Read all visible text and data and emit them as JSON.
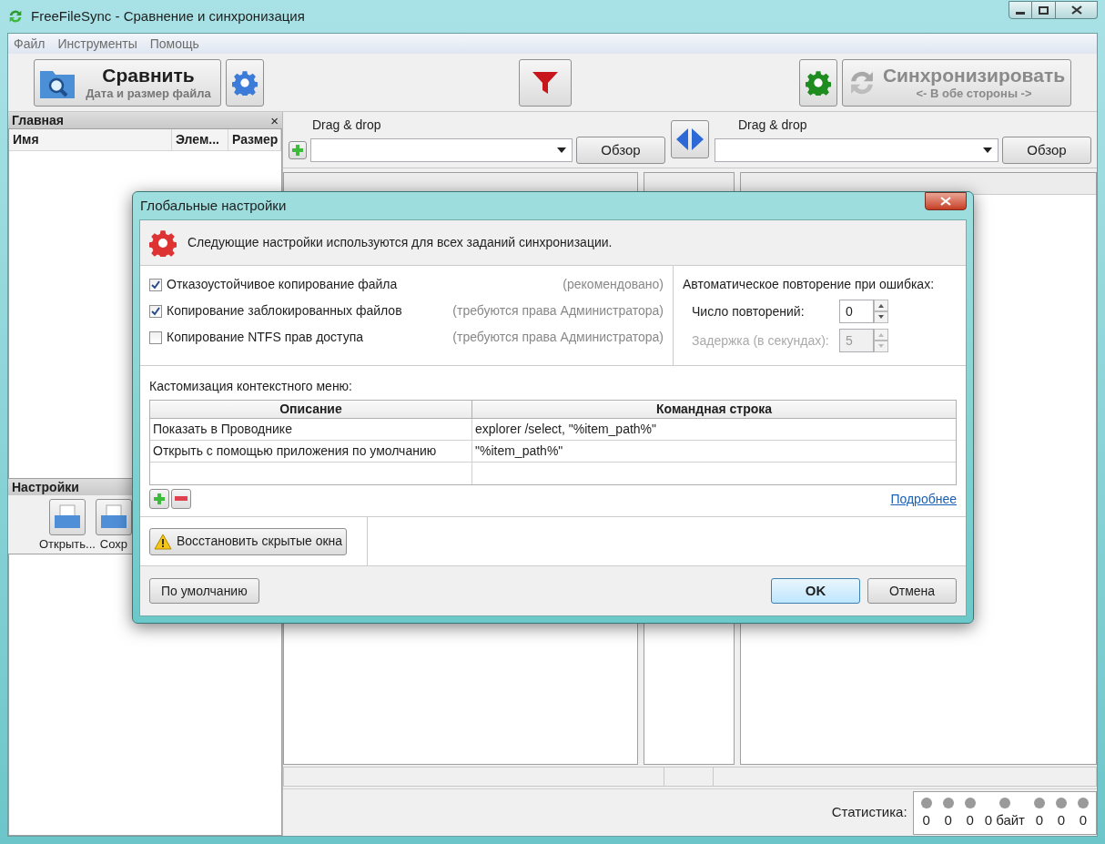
{
  "window": {
    "title": "FreeFileSync - Сравнение и синхронизация"
  },
  "menu": [
    "Файл",
    "Инструменты",
    "Помощь"
  ],
  "toolbar": {
    "compare": {
      "label": "Сравнить",
      "sublabel": "Дата и размер файла"
    },
    "sync": {
      "label": "Синхронизировать",
      "sublabel": "<- В обе стороны ->"
    }
  },
  "left_panel": {
    "title": "Главная",
    "close": "×",
    "columns": [
      "Имя",
      "Элем...",
      "Размер"
    ]
  },
  "folders": [
    {
      "label": "Drag & drop",
      "browse": "Обзор"
    },
    {
      "label": "Drag & drop",
      "browse": "Обзор"
    }
  ],
  "settings_panel": {
    "title": "Настройки",
    "buttons": [
      "Открыть...",
      "Сохр"
    ]
  },
  "statistics": {
    "label": "Статистика:",
    "counts": [
      "0",
      "0",
      "0",
      "0 байт",
      "0",
      "0",
      "0"
    ]
  },
  "dialog": {
    "title": "Глобальные настройки",
    "info": "Следующие настройки используются для всех заданий синхронизации.",
    "options": [
      {
        "label": "Отказоустойчивое копирование файла",
        "note": "(рекомендовано)",
        "checked": true
      },
      {
        "label": "Копирование заблокированных файлов",
        "note": "(требуются права Администратора)",
        "checked": true
      },
      {
        "label": "Копирование NTFS прав доступа",
        "note": "(требуются права Администратора)",
        "checked": false
      }
    ],
    "retry": {
      "title": "Автоматическое повторение при ошибках:",
      "fields": [
        {
          "label": "Число повторений:",
          "value": "0",
          "disabled": false
        },
        {
          "label": "Задержка (в секундах):",
          "value": "5",
          "disabled": true
        }
      ]
    },
    "context_menu": {
      "title": "Кастомизация контекстного меню:",
      "columns": [
        "Описание",
        "Командная строка"
      ],
      "rows": [
        [
          "Показать в Проводнике",
          "explorer /select, \"%item_path%\""
        ],
        [
          "Открыть с помощью приложения по умолчанию",
          "\"%item_path%\""
        ]
      ]
    },
    "more_link": "Подробнее",
    "restore_button": "Восстановить скрытые окна",
    "buttons": {
      "default": "По умолчанию",
      "ok": "OK",
      "cancel": "Отмена"
    }
  }
}
